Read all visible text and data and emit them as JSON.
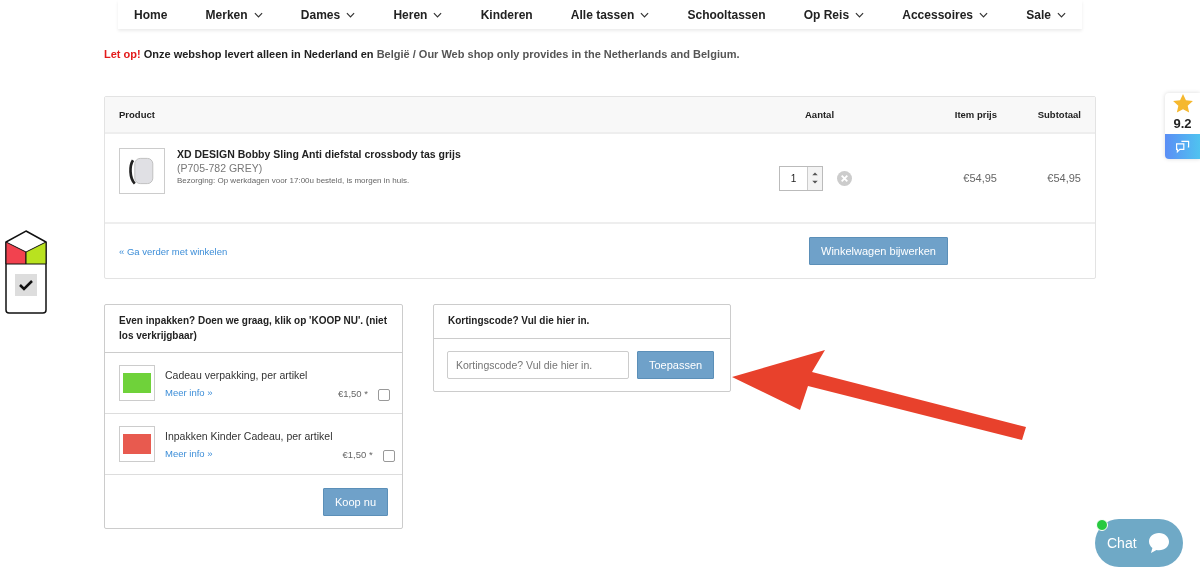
{
  "nav": [
    {
      "label": "Home",
      "dropdown": false
    },
    {
      "label": "Merken",
      "dropdown": true
    },
    {
      "label": "Dames",
      "dropdown": true
    },
    {
      "label": "Heren",
      "dropdown": true
    },
    {
      "label": "Kinderen",
      "dropdown": false
    },
    {
      "label": "Alle tassen",
      "dropdown": true
    },
    {
      "label": "Schooltassen",
      "dropdown": false
    },
    {
      "label": "Op Reis",
      "dropdown": true
    },
    {
      "label": "Accessoires",
      "dropdown": true
    },
    {
      "label": "Sale",
      "dropdown": true
    }
  ],
  "notice": {
    "alert": "Let op!",
    "text": "Onze webshop levert alleen in Nederland en",
    "rest": "België / Our Web shop only provides in the Netherlands and Belgium."
  },
  "cart": {
    "columns": [
      "Product",
      "Aantal",
      "Item prijs",
      "Subtotaal"
    ],
    "rows": [
      {
        "name": "XD DESIGN Bobby Sling Anti diefstal crossbody tas grijs",
        "sku": "(P705-782 GREY)",
        "delivery": "Bezorging: Op werkdagen voor 17:00u besteld, is morgen in huis.",
        "quantity": "1",
        "price": "€54,95",
        "subtotal": "€54,95"
      }
    ],
    "continue_link": "« Ga verder met winkelen",
    "update_button": "Winkelwagen bijwerken"
  },
  "gift": {
    "title": "Even inpakken? Doen we graag, klik op 'KOOP NU'. (niet los verkrijgbaar)",
    "items": [
      {
        "name": "Cadeau verpakking, per artikel",
        "link": "Meer info »",
        "price": "€1,50 *",
        "checked": false,
        "kind": "green"
      },
      {
        "name": "Inpakken Kinder Cadeau, per artikel",
        "link": "Meer info »",
        "price": "€1,50 *",
        "checked": false,
        "kind": "colorful"
      }
    ],
    "button": "Koop nu"
  },
  "coupon": {
    "title": "Kortingscode? Vul die hier in.",
    "placeholder": "Kortingscode? Vul die hier in.",
    "button": "Toepassen"
  },
  "rating": {
    "score": "9.2"
  },
  "chat": {
    "label": "Chat",
    "online": true
  }
}
